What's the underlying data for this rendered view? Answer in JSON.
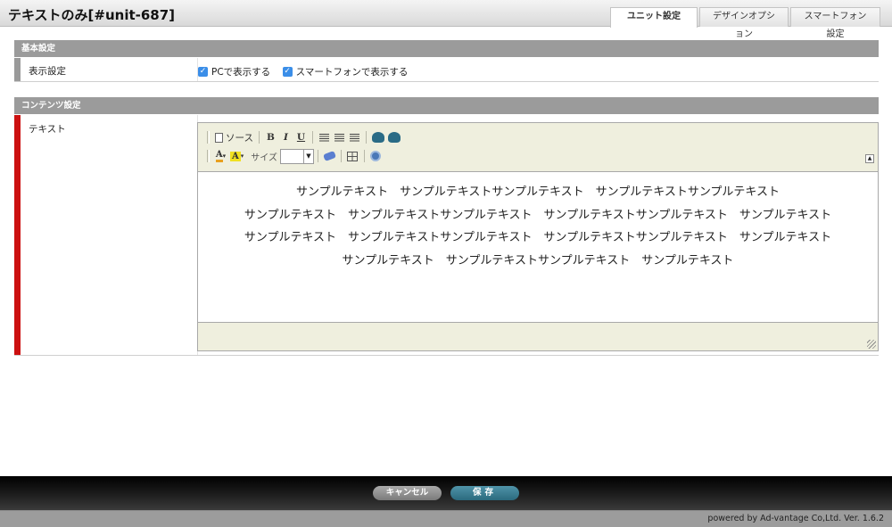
{
  "header": {
    "title": "テキストのみ[#unit-687]",
    "tabs": [
      {
        "label": "ユニット設定",
        "active": true
      },
      {
        "label": "デザインオプション",
        "active": false
      },
      {
        "label": "スマートフォン設定",
        "active": false
      }
    ]
  },
  "basic_settings": {
    "heading": "基本設定",
    "display_label": "表示設定",
    "pc_checkbox": "PCで表示する",
    "sp_checkbox": "スマートフォンで表示する"
  },
  "content_settings": {
    "heading": "コンテンツ設定",
    "text_label": "テキスト"
  },
  "editor": {
    "source_label": "ソース",
    "bold": "B",
    "italic": "I",
    "underline": "U",
    "font_color": "A",
    "bg_color": "A",
    "size_label": "サイズ",
    "lines": [
      "サンプルテキスト　サンプルテキストサンプルテキスト　サンプルテキストサンプルテキスト",
      "サンプルテキスト　サンプルテキストサンプルテキスト　サンプルテキストサンプルテキスト　サンプルテキスト",
      "サンプルテキスト　サンプルテキストサンプルテキスト　サンプルテキストサンプルテキスト　サンプルテキスト",
      "サンプルテキスト　サンプルテキストサンプルテキスト　サンプルテキスト"
    ]
  },
  "footer": {
    "cancel": "キャンセル",
    "save": "保存",
    "version": "powered by Ad-vantage Co,Ltd. Ver. 1.6.2"
  },
  "colors": {
    "accent_bar_basic": "#9a9a9a",
    "accent_bar_content": "#cc1111",
    "save_button": "#2b6a7e"
  }
}
